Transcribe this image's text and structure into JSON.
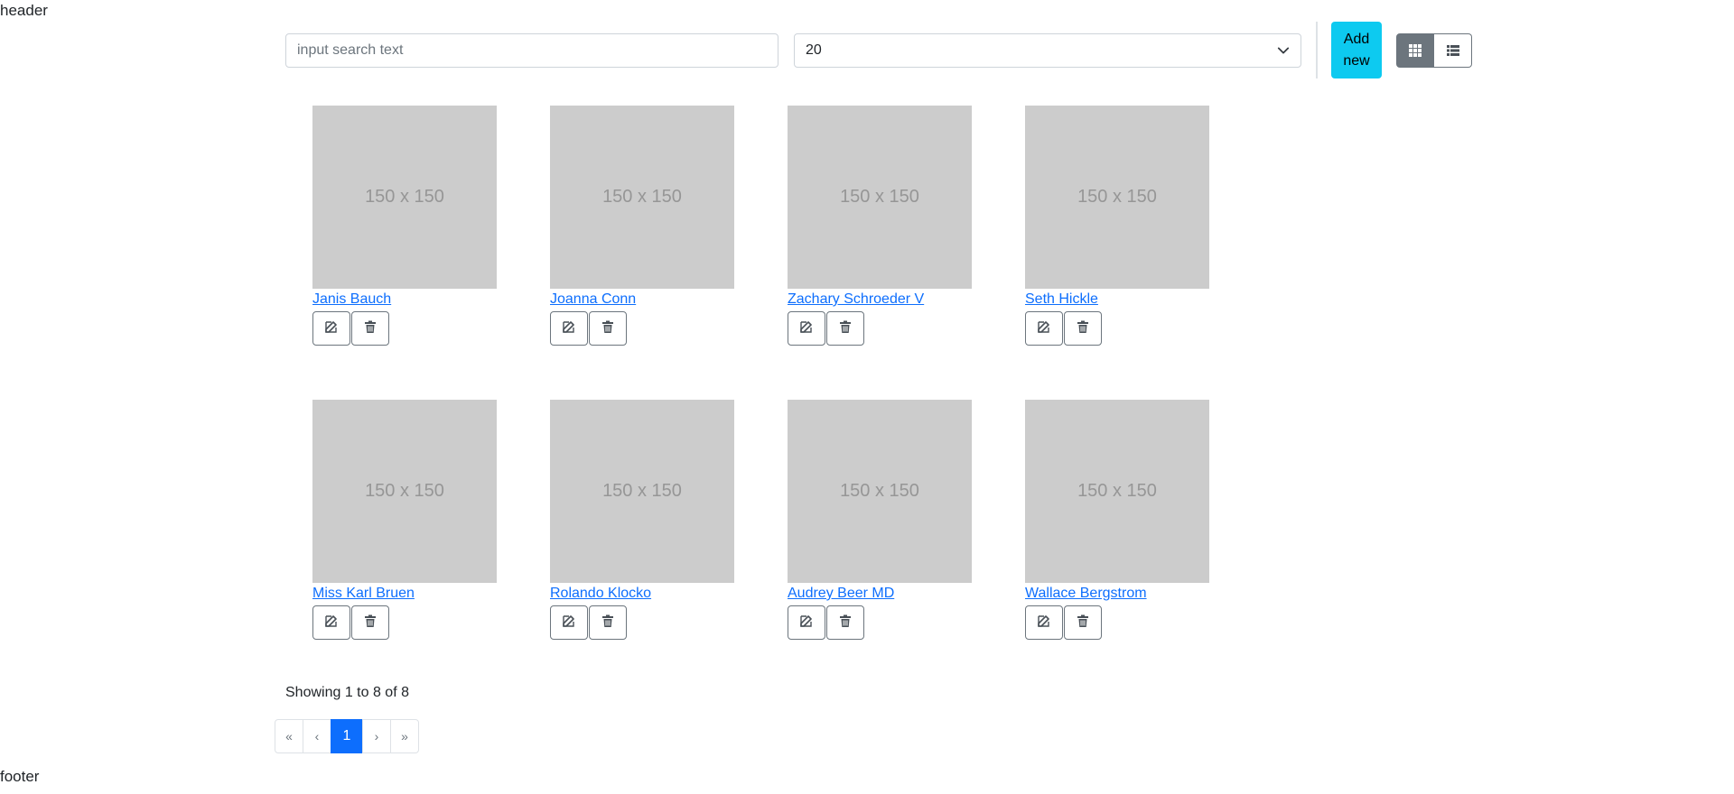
{
  "header": {
    "text": "header"
  },
  "footer": {
    "text": "footer"
  },
  "toolbar": {
    "search_placeholder": "input search text",
    "search_value": "",
    "page_size": "20",
    "add_label": "Add new",
    "view_mode": "grid"
  },
  "cards": [
    {
      "image_text": "150 x 150",
      "name": "Janis Bauch"
    },
    {
      "image_text": "150 x 150",
      "name": "Joanna Conn"
    },
    {
      "image_text": "150 x 150",
      "name": "Zachary Schroeder V"
    },
    {
      "image_text": "150 x 150",
      "name": "Seth Hickle"
    },
    {
      "image_text": "150 x 150",
      "name": "Miss Karl Bruen"
    },
    {
      "image_text": "150 x 150",
      "name": "Rolando Klocko"
    },
    {
      "image_text": "150 x 150",
      "name": "Audrey Beer MD"
    },
    {
      "image_text": "150 x 150",
      "name": "Wallace Bergstrom"
    }
  ],
  "summary": "Showing 1 to 8 of 8",
  "pagination": {
    "first": "«",
    "prev": "‹",
    "current": "1",
    "next": "›",
    "last": "»"
  },
  "colors": {
    "accent": "#0dcaf0",
    "primary": "#0d6efd",
    "secondary": "#6c757d",
    "placeholder_bg": "#cccccc"
  }
}
